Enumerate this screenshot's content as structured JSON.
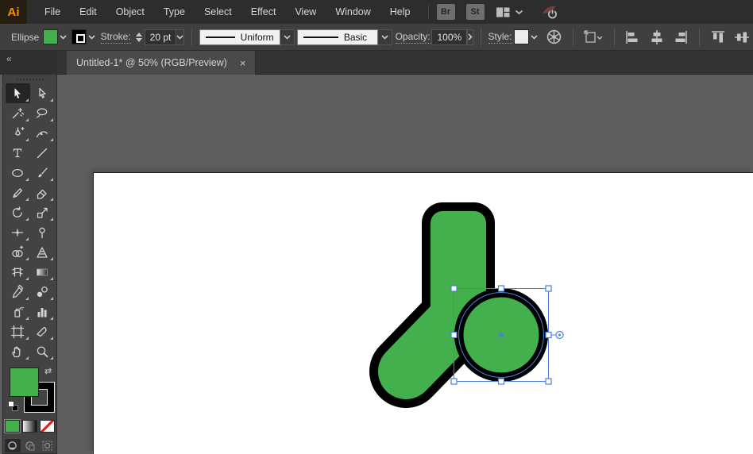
{
  "menu_bar": {
    "logo": "Ai",
    "items": [
      "File",
      "Edit",
      "Object",
      "Type",
      "Select",
      "Effect",
      "View",
      "Window",
      "Help"
    ],
    "bridge_label": "Br",
    "stock_label": "St"
  },
  "control_bar": {
    "tool_label": "Ellipse",
    "stroke_label": "Stroke:",
    "stroke_value": "20 pt",
    "variable_width_profile": "Uniform",
    "brush_definition": "Basic",
    "opacity_label": "Opacity:",
    "opacity_value": "100%",
    "style_label": "Style:"
  },
  "document_tab": {
    "title": "Untitled-1* @ 50% (RGB/Preview)",
    "close_glyph": "×",
    "zoom_level": "50%",
    "color_mode": "RGB/Preview"
  },
  "toolbar": {
    "collapse_glyph": "«",
    "swap_glyph": "⇄",
    "tools": [
      {
        "name": "selection-tool",
        "active": true
      },
      {
        "name": "direct-selection-tool",
        "active": false
      },
      {
        "name": "magic-wand-tool",
        "active": false
      },
      {
        "name": "lasso-tool",
        "active": false
      },
      {
        "name": "pen-tool",
        "active": false
      },
      {
        "name": "curvature-tool",
        "active": false
      },
      {
        "name": "type-tool",
        "active": false
      },
      {
        "name": "line-segment-tool",
        "active": false
      },
      {
        "name": "ellipse-tool",
        "active": false
      },
      {
        "name": "paintbrush-tool",
        "active": false
      },
      {
        "name": "pencil-tool",
        "active": false
      },
      {
        "name": "eraser-tool",
        "active": false
      },
      {
        "name": "rotate-tool",
        "active": false
      },
      {
        "name": "scale-tool",
        "active": false
      },
      {
        "name": "width-tool",
        "active": false
      },
      {
        "name": "puppet-warp-tool",
        "active": false
      },
      {
        "name": "shape-builder-tool",
        "active": false
      },
      {
        "name": "perspective-grid-tool",
        "active": false
      },
      {
        "name": "mesh-tool",
        "active": false
      },
      {
        "name": "gradient-tool",
        "active": false
      },
      {
        "name": "eyedropper-tool",
        "active": false
      },
      {
        "name": "blend-tool",
        "active": false
      },
      {
        "name": "symbol-sprayer-tool",
        "active": false
      },
      {
        "name": "column-graph-tool",
        "active": false
      },
      {
        "name": "artboard-tool",
        "active": false
      },
      {
        "name": "slice-tool",
        "active": false
      },
      {
        "name": "hand-tool",
        "active": false
      },
      {
        "name": "zoom-tool",
        "active": false
      }
    ]
  },
  "canvas": {
    "shapes": [
      {
        "name": "bent-rounded-bar",
        "fill": "#44AF4D",
        "stroke": "#000000",
        "stroke_weight": "20 pt",
        "selected": false
      },
      {
        "name": "ellipse",
        "fill": "#44AF4D",
        "stroke": "#000000",
        "stroke_weight": "20 pt",
        "selected": true
      }
    ]
  },
  "colors": {
    "artwork_green": "#44AF4D",
    "artwork_stroke": "#000000",
    "selection_blue": "#4A7FE0",
    "canvas_gray": "#5E5E5E",
    "artboard_white": "#FFFFFF",
    "chrome_dark": "#2D2D2D",
    "logo_orange": "#F79500"
  }
}
